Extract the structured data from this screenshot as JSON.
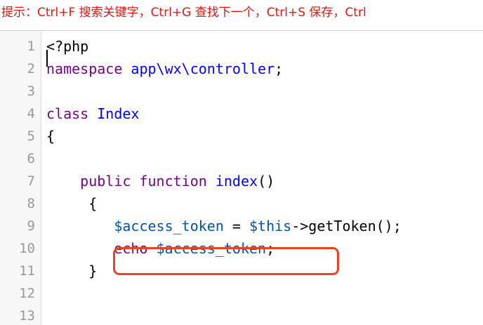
{
  "tip": {
    "text": "提示：Ctrl+F 搜索关键字，Ctrl+G 查找下一个，Ctrl+S 保存，Ctrl"
  },
  "editor": {
    "line_numbers": [
      "1",
      "2",
      "3",
      "4",
      "5",
      "6",
      "7",
      "8",
      "9",
      "10",
      "11",
      "12",
      "13"
    ],
    "lines": [
      [
        {
          "t": "<?php",
          "c": ""
        }
      ],
      [
        {
          "t": "namespace",
          "c": "kw"
        },
        {
          "t": " ",
          "c": ""
        },
        {
          "t": "app\\wx\\controller",
          "c": "def"
        },
        {
          "t": ";",
          "c": ""
        }
      ],
      [],
      [
        {
          "t": "class",
          "c": "kw"
        },
        {
          "t": " ",
          "c": ""
        },
        {
          "t": "Index",
          "c": "def"
        }
      ],
      [
        {
          "t": "{",
          "c": ""
        }
      ],
      [],
      [
        {
          "t": "    ",
          "c": ""
        },
        {
          "t": "public",
          "c": "kw"
        },
        {
          "t": " ",
          "c": ""
        },
        {
          "t": "function",
          "c": "kw"
        },
        {
          "t": " ",
          "c": ""
        },
        {
          "t": "index",
          "c": "def"
        },
        {
          "t": "()",
          "c": ""
        }
      ],
      [
        {
          "t": "     {",
          "c": ""
        }
      ],
      [
        {
          "t": "        ",
          "c": ""
        },
        {
          "t": "$access_token",
          "c": "var"
        },
        {
          "t": " = ",
          "c": ""
        },
        {
          "t": "$this",
          "c": "var"
        },
        {
          "t": "->getToken();",
          "c": ""
        }
      ],
      [
        {
          "t": "        ",
          "c": ""
        },
        {
          "t": "echo",
          "c": "kw"
        },
        {
          "t": " ",
          "c": ""
        },
        {
          "t": "$access_token",
          "c": "var"
        },
        {
          "t": ";",
          "c": ""
        }
      ],
      [
        {
          "t": "     }",
          "c": ""
        }
      ],
      [],
      []
    ]
  },
  "colors": {
    "tip_text": "#e8140e",
    "keyword": "#770088",
    "definition": "#0000ff",
    "variable": "#0055aa",
    "highlight_border": "#f0421f"
  }
}
